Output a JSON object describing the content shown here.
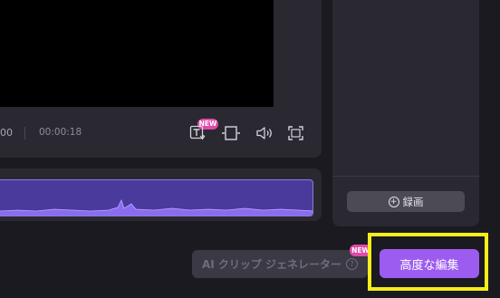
{
  "player": {
    "current_time": "00",
    "total_time": "00:00:18",
    "new_badge": "NEW"
  },
  "record": {
    "label": "録画"
  },
  "footer": {
    "ai_clip_label": "AI クリップ ジェネレーター",
    "ai_clip_badge": "NEW",
    "advanced_edit_label": "高度な編集"
  },
  "colors": {
    "background": "#1b1a21",
    "panel": "#2a2932",
    "accent": "#9c5cf0",
    "badge": "#e04aa8",
    "highlight": "#f5ee1a",
    "waveform": "#4a3a9c"
  },
  "icons": [
    "text-to-speech-icon",
    "crop-frame-icon",
    "volume-icon",
    "fullscreen-icon",
    "plus-circle-icon",
    "help-icon"
  ]
}
